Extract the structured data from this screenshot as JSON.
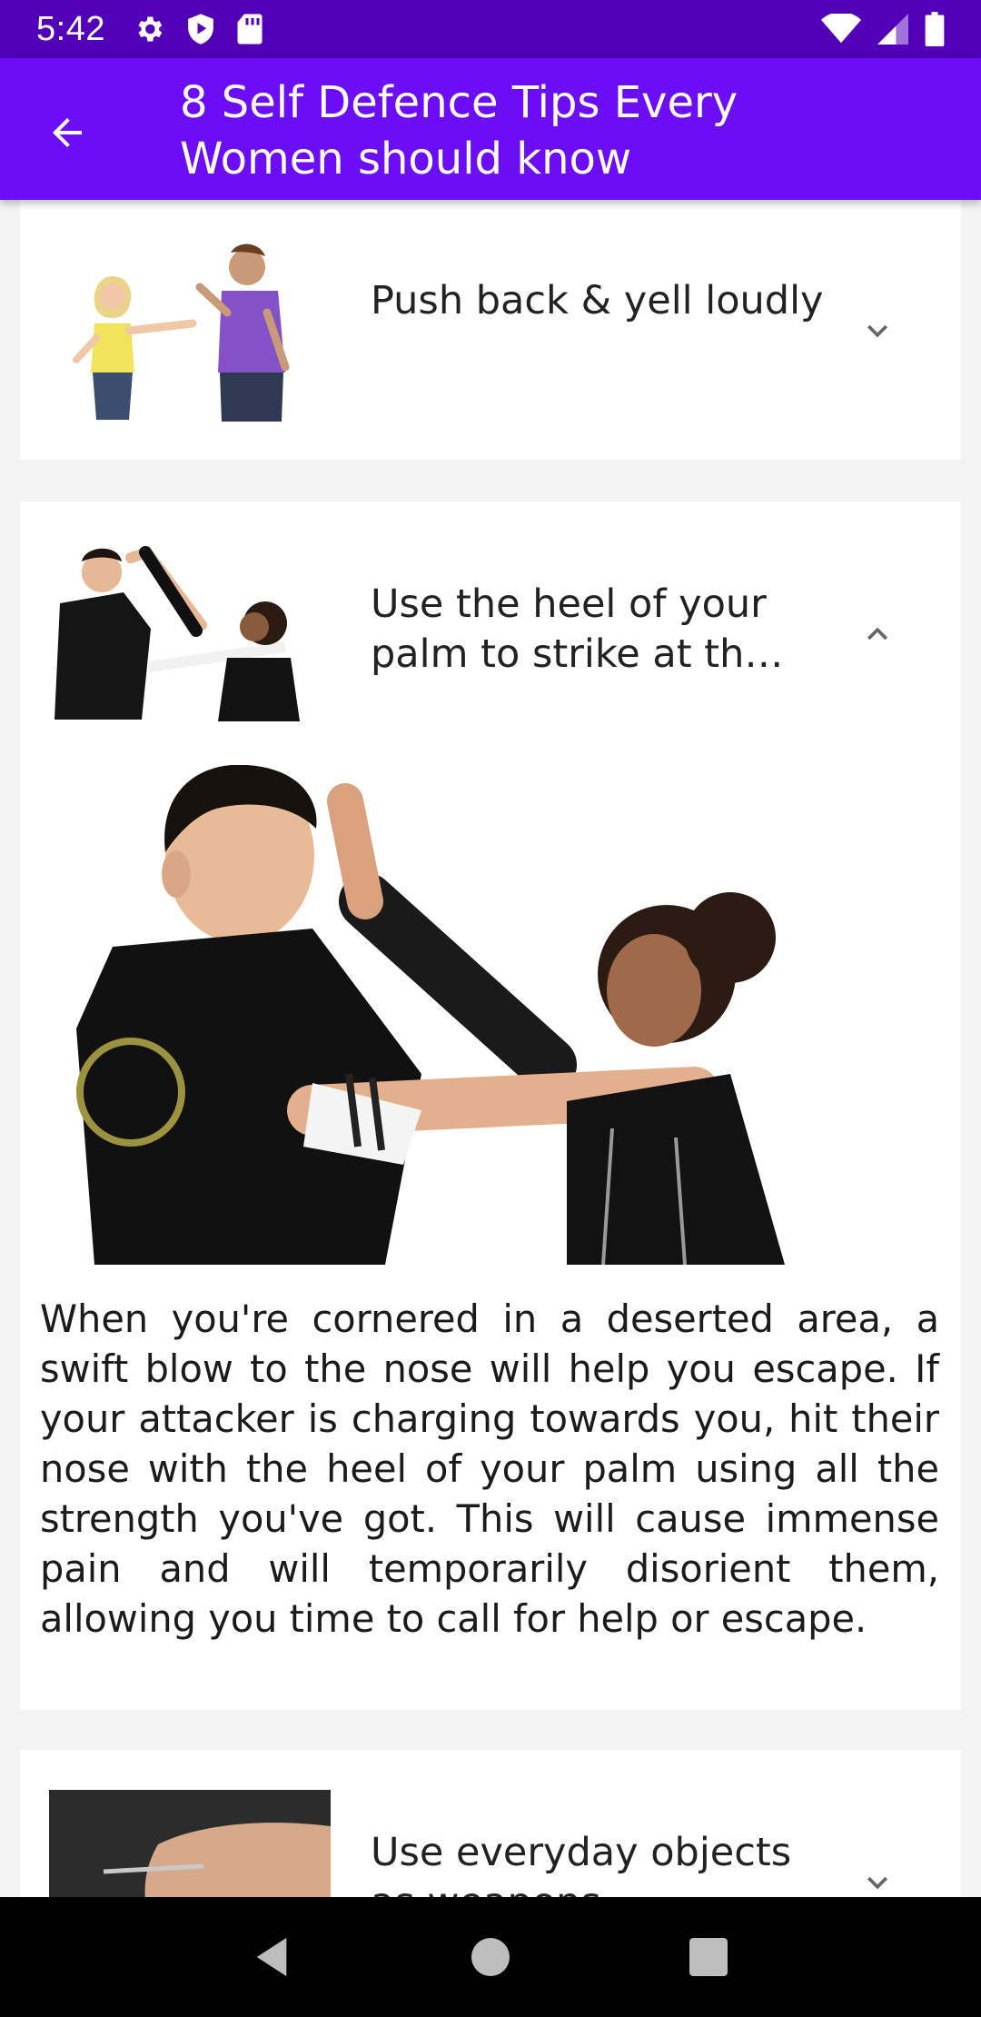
{
  "status_bar": {
    "time": "5:42",
    "left_icons": [
      "settings-gear-icon",
      "play-shield-icon",
      "sd-card-icon"
    ],
    "right_icons": [
      "wifi-icon",
      "cellular-signal-icon",
      "battery-icon"
    ]
  },
  "app_bar": {
    "title": "8 Self Defence Tips Every Women should know",
    "back_icon": "arrow-back-icon",
    "color": "#6c0ef5"
  },
  "tips": [
    {
      "title": "Push back & yell loudly",
      "expanded": false,
      "chevron": "chevron-down-icon"
    },
    {
      "title": "Use the heel of your palm to strike at th…",
      "expanded": true,
      "chevron": "chevron-up-icon",
      "description": "When you're cornered in a deserted area, a swift blow to the nose will help you escape. If your attacker is charging towards you, hit their nose with the heel of your palm using all the strength you've got. This will cause immense pain and will temporarily disorient them, allowing you time to call for help or escape."
    },
    {
      "title": "Use everyday objects as weapons",
      "expanded": false,
      "chevron": "chevron-down-icon"
    }
  ],
  "nav_bar": {
    "icons": [
      "nav-back-icon",
      "nav-home-icon",
      "nav-recents-icon"
    ]
  }
}
